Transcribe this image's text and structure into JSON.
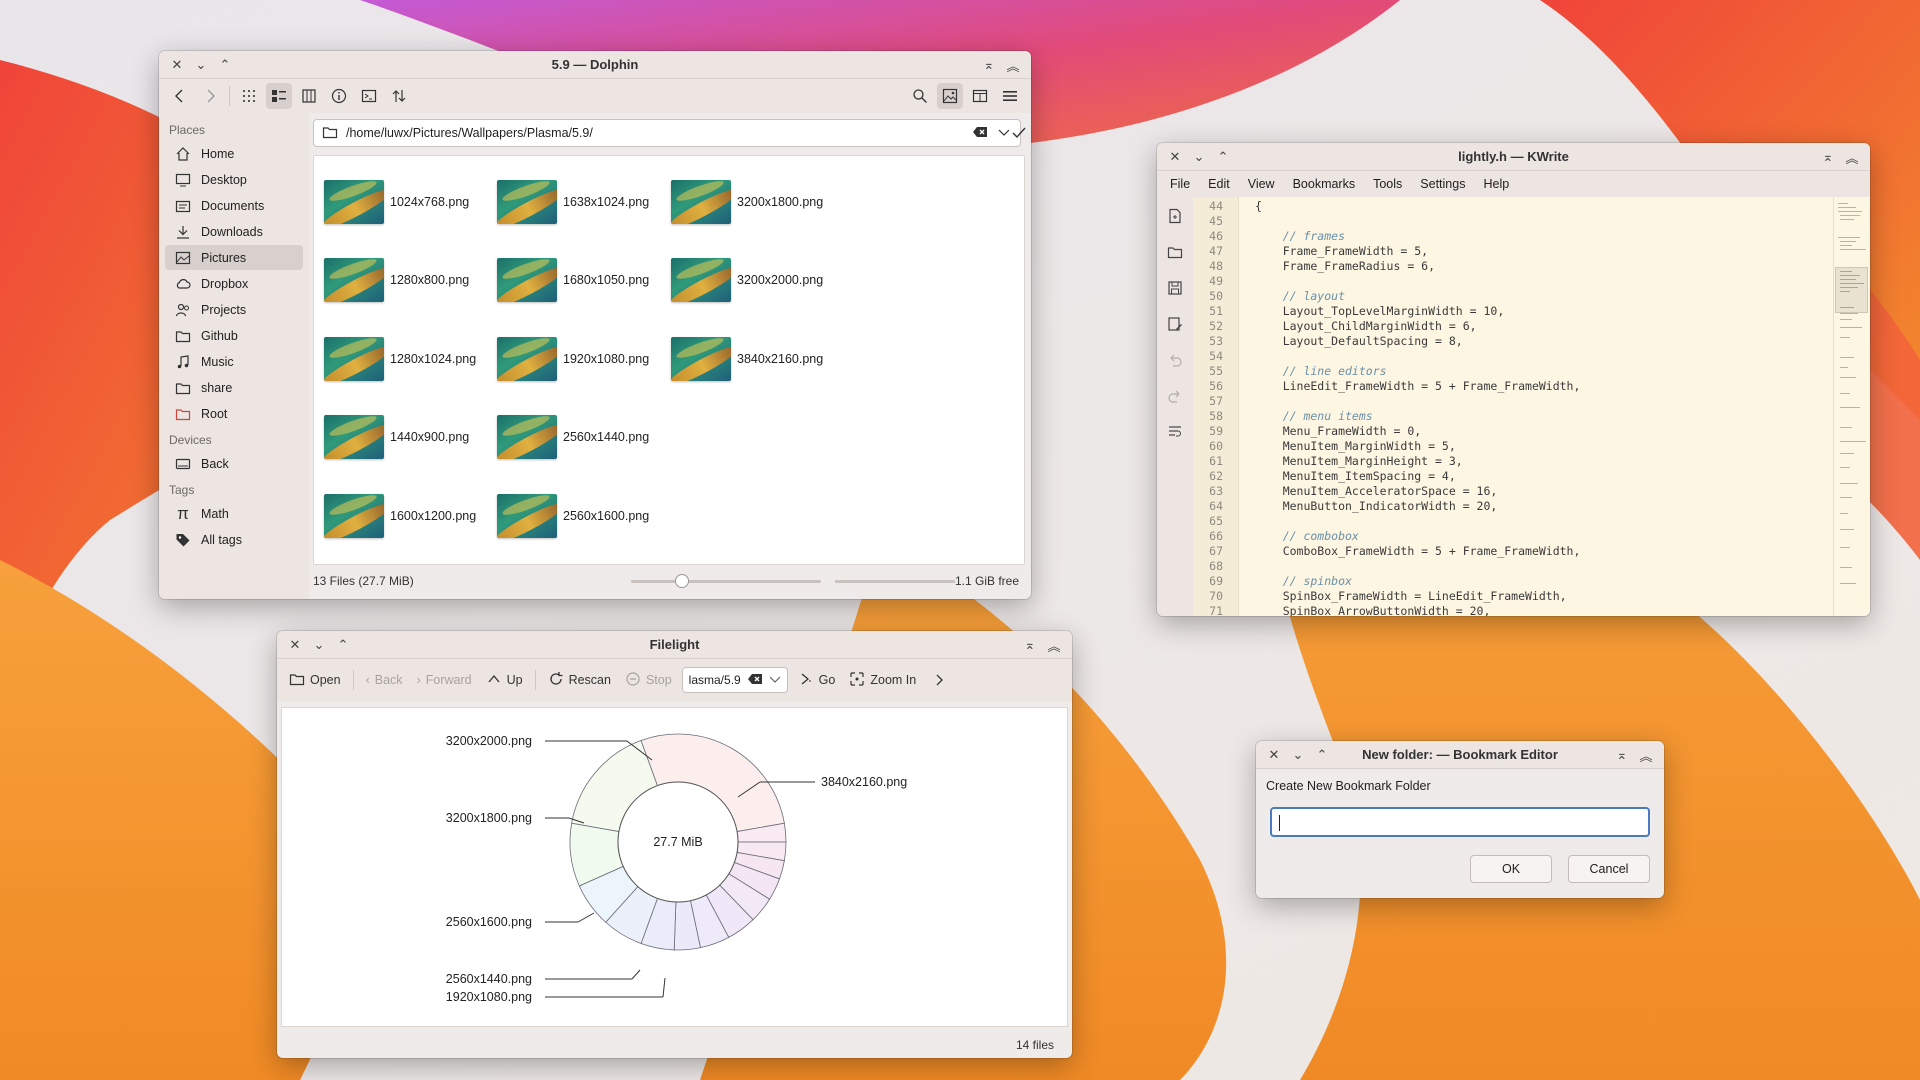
{
  "dolphin": {
    "title": "5.9 — Dolphin",
    "places_header": "Places",
    "places": [
      {
        "label": "Home",
        "icon": "home-icon"
      },
      {
        "label": "Desktop",
        "icon": "desktop-icon"
      },
      {
        "label": "Documents",
        "icon": "documents-icon"
      },
      {
        "label": "Downloads",
        "icon": "downloads-icon"
      },
      {
        "label": "Pictures",
        "icon": "pictures-icon",
        "selected": true
      },
      {
        "label": "Dropbox",
        "icon": "cloud-icon"
      },
      {
        "label": "Projects",
        "icon": "projects-icon"
      },
      {
        "label": "Github",
        "icon": "folder-icon"
      },
      {
        "label": "Music",
        "icon": "music-icon"
      },
      {
        "label": "share",
        "icon": "folder-icon"
      },
      {
        "label": "Root",
        "icon": "root-folder-icon"
      }
    ],
    "devices_header": "Devices",
    "devices": [
      {
        "label": "Back",
        "icon": "drive-icon"
      }
    ],
    "tags_header": "Tags",
    "tags": [
      {
        "label": "Math",
        "icon": "pi-icon"
      },
      {
        "label": "All tags",
        "icon": "tag-icon"
      }
    ],
    "path": "/home/luwx/Pictures/Wallpapers/Plasma/5.9/",
    "files": [
      "1024x768.png",
      "1638x1024.png",
      "3200x1800.png",
      "1280x800.png",
      "1680x1050.png",
      "3200x2000.png",
      "1280x1024.png",
      "1920x1080.png",
      "3840x2160.png",
      "1440x900.png",
      "2560x1440.png",
      "1600x1200.png",
      "2560x1600.png"
    ],
    "status_count": "13 Files (27.7 MiB)",
    "status_free": "1.1 GiB free"
  },
  "kwrite": {
    "title": "lightly.h — KWrite",
    "menu": [
      "File",
      "Edit",
      "View",
      "Bookmarks",
      "Tools",
      "Settings",
      "Help"
    ],
    "lines": [
      {
        "n": "44",
        "code": "{"
      },
      {
        "n": "45",
        "code": ""
      },
      {
        "n": "46",
        "code": "    // frames"
      },
      {
        "n": "47",
        "code": "    Frame_FrameWidth = 5,"
      },
      {
        "n": "48",
        "code": "    Frame_FrameRadius = 6,"
      },
      {
        "n": "49",
        "code": ""
      },
      {
        "n": "50",
        "code": "    // layout"
      },
      {
        "n": "51",
        "code": "    Layout_TopLevelMarginWidth = 10,"
      },
      {
        "n": "52",
        "code": "    Layout_ChildMarginWidth = 6,"
      },
      {
        "n": "53",
        "code": "    Layout_DefaultSpacing = 8,"
      },
      {
        "n": "54",
        "code": ""
      },
      {
        "n": "55",
        "code": "    // line editors"
      },
      {
        "n": "56",
        "code": "    LineEdit_FrameWidth = 5 + Frame_FrameWidth,"
      },
      {
        "n": "57",
        "code": ""
      },
      {
        "n": "58",
        "code": "    // menu items"
      },
      {
        "n": "59",
        "code": "    Menu_FrameWidth = 0,"
      },
      {
        "n": "60",
        "code": "    MenuItem_MarginWidth = 5,"
      },
      {
        "n": "61",
        "code": "    MenuItem_MarginHeight = 3,"
      },
      {
        "n": "62",
        "code": "    MenuItem_ItemSpacing = 4,"
      },
      {
        "n": "63",
        "code": "    MenuItem_AcceleratorSpace = 16,"
      },
      {
        "n": "64",
        "code": "    MenuButton_IndicatorWidth = 20,"
      },
      {
        "n": "65",
        "code": ""
      },
      {
        "n": "66",
        "code": "    // combobox"
      },
      {
        "n": "67",
        "code": "    ComboBox_FrameWidth = 5 + Frame_FrameWidth,"
      },
      {
        "n": "68",
        "code": ""
      },
      {
        "n": "69",
        "code": "    // spinbox"
      },
      {
        "n": "70",
        "code": "    SpinBox_FrameWidth = LineEdit_FrameWidth,"
      },
      {
        "n": "71",
        "code": "    SpinBox_ArrowButtonWidth = 20,"
      }
    ]
  },
  "filelight": {
    "title": "Filelight",
    "toolbar": {
      "open": "Open",
      "back": "Back",
      "forward": "Forward",
      "up": "Up",
      "rescan": "Rescan",
      "stop": "Stop",
      "go": "Go",
      "zoom_in": "Zoom In"
    },
    "location": "lasma/5.9",
    "center": "27.7 MiB",
    "labels": {
      "l1": "3200x2000.png",
      "l2": "3200x1800.png",
      "l3": "2560x1600.png",
      "l4": "2560x1440.png",
      "l5": "1920x1080.png",
      "r1": "3840x2160.png"
    },
    "status": "14 files"
  },
  "bookmark": {
    "title": "New folder: — Bookmark Editor",
    "label": "Create New Bookmark Folder",
    "input_value": "",
    "ok": "OK",
    "cancel": "Cancel"
  }
}
